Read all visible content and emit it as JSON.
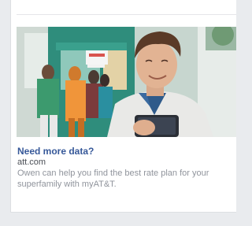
{
  "ad": {
    "title": "Need more data?",
    "domain": "att.com",
    "description": "Owen can help you find the best rate plan for your superfamily with myAT&T."
  },
  "colors": {
    "title": "#365899",
    "domain": "#4b4f56",
    "description": "#90949c",
    "background": "#e9ebee"
  }
}
